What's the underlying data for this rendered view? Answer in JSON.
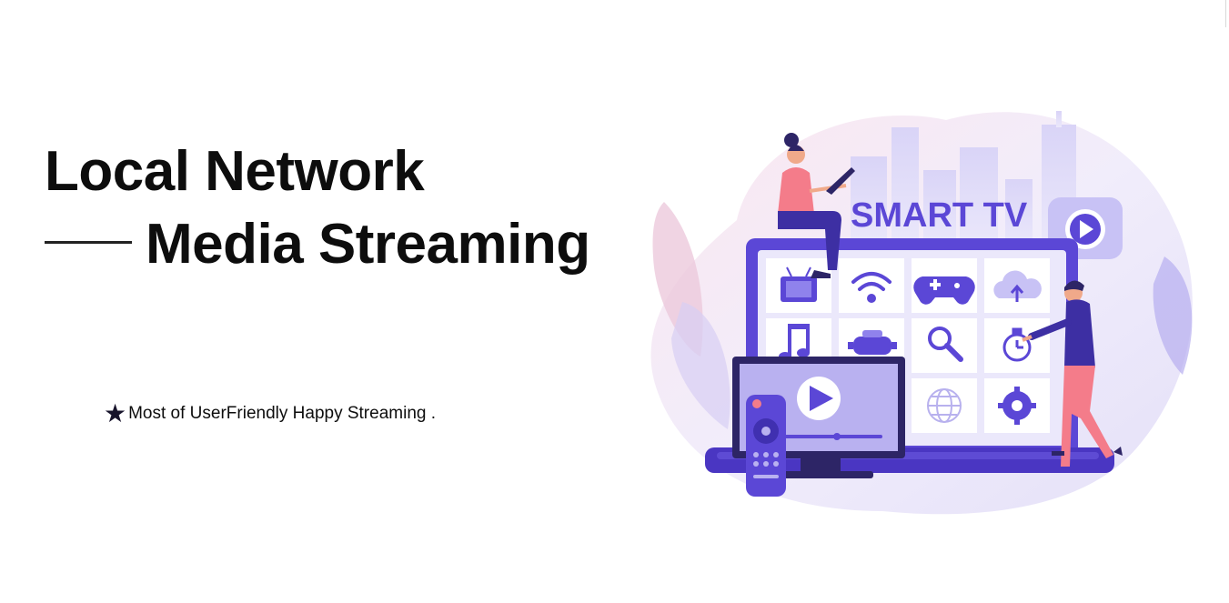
{
  "hero": {
    "title_line1": "Local Network",
    "title_line2": "Media Streaming",
    "tagline_icon": "star-icon",
    "tagline": "Most of UserFriendly Happy Streaming ."
  },
  "illustration": {
    "label": "SMART TV",
    "tiles": [
      "tv-icon",
      "wifi-icon",
      "gamepad-icon",
      "cloud-upload-icon",
      "music-icon",
      "vr-headset-icon",
      "search-icon",
      "stopwatch-icon",
      "blank",
      "blank",
      "globe-icon",
      "gear-icon"
    ]
  },
  "colors": {
    "accent": "#5b47d6",
    "accent_light": "#c8c2f5",
    "pink": "#f47c8a",
    "text": "#0d0d0d"
  }
}
